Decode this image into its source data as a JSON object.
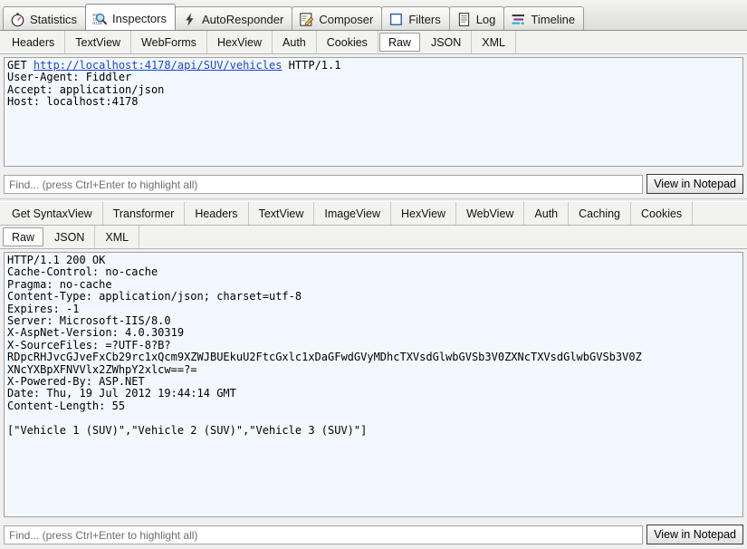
{
  "main_tabs": [
    {
      "label": "Statistics",
      "icon": "stopwatch-icon",
      "active": false
    },
    {
      "label": "Inspectors",
      "icon": "inspectors-icon",
      "active": true
    },
    {
      "label": "AutoResponder",
      "icon": "lightning-icon",
      "active": false
    },
    {
      "label": "Composer",
      "icon": "notepad-pencil-icon",
      "active": false
    },
    {
      "label": "Filters",
      "icon": "filter-square-icon",
      "active": false
    },
    {
      "label": "Log",
      "icon": "log-document-icon",
      "active": false
    },
    {
      "label": "Timeline",
      "icon": "timeline-bars-icon",
      "active": false
    }
  ],
  "request": {
    "tabs": [
      {
        "label": "Headers",
        "active": false
      },
      {
        "label": "TextView",
        "active": false
      },
      {
        "label": "WebForms",
        "active": false
      },
      {
        "label": "HexView",
        "active": false
      },
      {
        "label": "Auth",
        "active": false
      },
      {
        "label": "Cookies",
        "active": false
      },
      {
        "label": "Raw",
        "active": true
      },
      {
        "label": "JSON",
        "active": false
      },
      {
        "label": "XML",
        "active": false
      }
    ],
    "request_line_method": "GET ",
    "request_line_url": "http://localhost:4178/api/SUV/vehicles",
    "request_line_version": " HTTP/1.1",
    "headers": [
      "User-Agent: Fiddler",
      "Accept: application/json",
      "Host: localhost:4178"
    ],
    "find_placeholder": "Find... (press Ctrl+Enter to highlight all)",
    "find_value": "",
    "notepad_button": "View in Notepad"
  },
  "response": {
    "tabs_row1": [
      {
        "label": "Get SyntaxView",
        "active": false
      },
      {
        "label": "Transformer",
        "active": false
      },
      {
        "label": "Headers",
        "active": false
      },
      {
        "label": "TextView",
        "active": false
      },
      {
        "label": "ImageView",
        "active": false
      },
      {
        "label": "HexView",
        "active": false
      },
      {
        "label": "WebView",
        "active": false
      },
      {
        "label": "Auth",
        "active": false
      },
      {
        "label": "Caching",
        "active": false
      },
      {
        "label": "Cookies",
        "active": false
      }
    ],
    "tabs_row2": [
      {
        "label": "Raw",
        "active": true
      },
      {
        "label": "JSON",
        "active": false
      },
      {
        "label": "XML",
        "active": false
      }
    ],
    "status_line": "HTTP/1.1 200 OK",
    "headers": [
      "Cache-Control: no-cache",
      "Pragma: no-cache",
      "Content-Type: application/json; charset=utf-8",
      "Expires: -1",
      "Server: Microsoft-IIS/8.0",
      "X-AspNet-Version: 4.0.30319",
      "X-SourceFiles: =?UTF-8?B?",
      "RDpcRHJvcGJveFxCb29rc1xQcm9XZWJBUEkuU2FtcGxlc1xDaGFwdGVyMDhcTXVsdGlwbGVSb3V0ZXNcTXVsdGlwbGVSb3V0Z",
      "XNcYXBpXFNVVlx2ZWhpY2xlcw==?=",
      "X-Powered-By: ASP.NET",
      "Date: Thu, 19 Jul 2012 19:44:14 GMT",
      "Content-Length: 55"
    ],
    "body": "[\"Vehicle 1 (SUV)\",\"Vehicle 2 (SUV)\",\"Vehicle 3 (SUV)\"]",
    "find_placeholder": "Find... (press Ctrl+Enter to highlight all)",
    "find_value": "",
    "notepad_button": "View in Notepad"
  },
  "colors": {
    "link": "#1a45d8",
    "editor_bg": "#f2f8fe",
    "chrome_bg": "#f0f0f0"
  }
}
